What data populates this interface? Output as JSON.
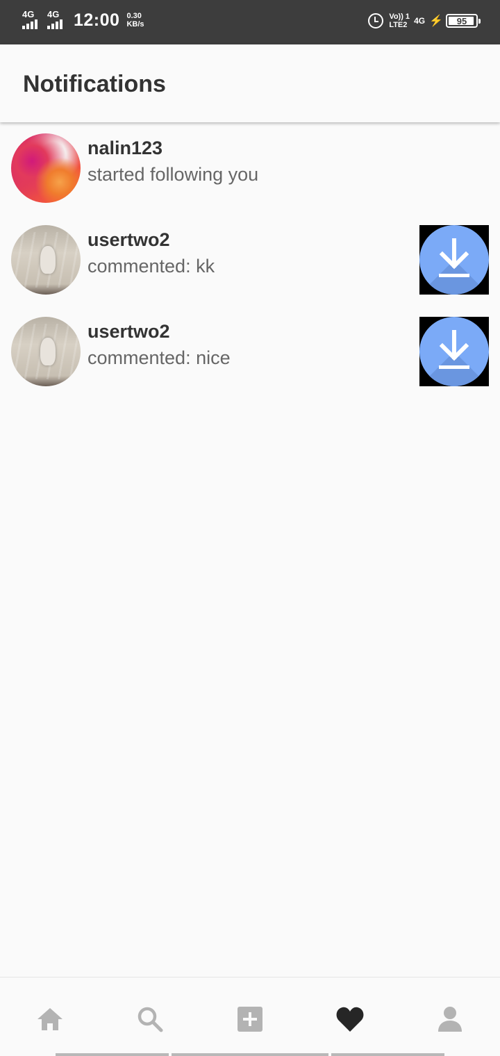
{
  "status_bar": {
    "sim1_network": "4G",
    "sim2_network": "4G",
    "time": "12:00",
    "speed_value": "0.30",
    "speed_unit": "KB/s",
    "volte_top": "Vo)) 1",
    "volte_bottom": "LTE2",
    "network_type": "4G",
    "battery_level": "95"
  },
  "header": {
    "title": "Notifications"
  },
  "notifications": [
    {
      "username": "nalin123",
      "message": "started following you",
      "avatar_icon": "profile-photo",
      "has_thumbnail": false
    },
    {
      "username": "usertwo2",
      "message": "commented: kk",
      "avatar_icon": "profile-photo",
      "has_thumbnail": true,
      "thumbnail_icon": "download-icon"
    },
    {
      "username": "usertwo2",
      "message": "commented: nice",
      "avatar_icon": "profile-photo",
      "has_thumbnail": true,
      "thumbnail_icon": "download-icon"
    }
  ],
  "bottom_nav": {
    "items": [
      {
        "name": "home",
        "icon": "home-icon",
        "active": false
      },
      {
        "name": "search",
        "icon": "search-icon",
        "active": false
      },
      {
        "name": "add",
        "icon": "add-post-icon",
        "active": false
      },
      {
        "name": "activity",
        "icon": "heart-icon",
        "active": true
      },
      {
        "name": "profile",
        "icon": "profile-icon",
        "active": false
      }
    ]
  },
  "colors": {
    "status_bar_bg": "#3d3d3d",
    "background": "#fafafa",
    "text_primary": "#333333",
    "text_secondary": "#666666",
    "icon_inactive": "#b3b3b3",
    "icon_active": "#262626",
    "download_blue": "#7baaf7"
  }
}
